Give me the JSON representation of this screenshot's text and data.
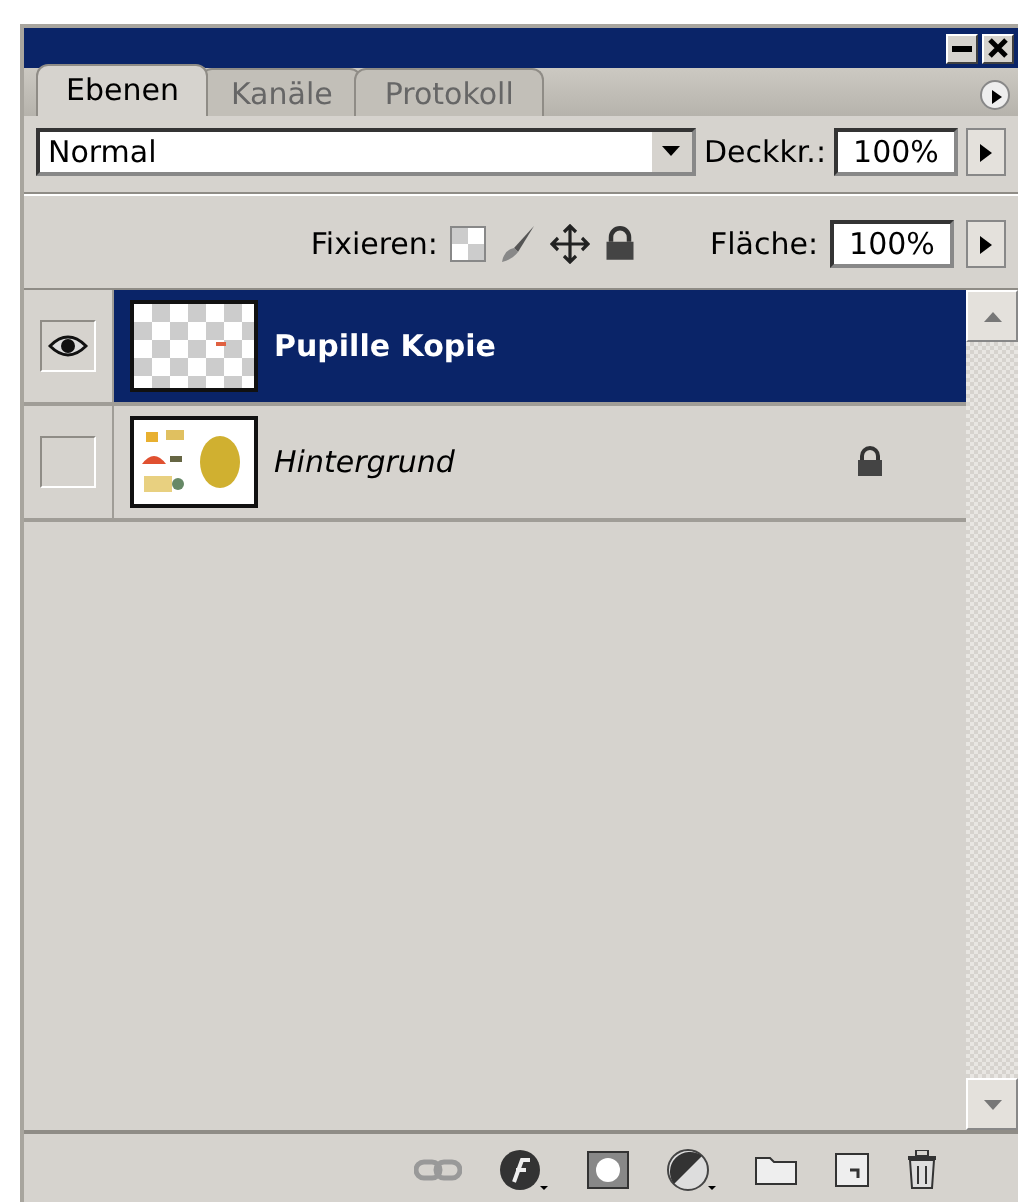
{
  "tabs": [
    {
      "label": "Ebenen",
      "selected": true
    },
    {
      "label": "Kanäle",
      "selected": false
    },
    {
      "label": "Protokoll",
      "selected": false
    }
  ],
  "blend_mode": {
    "value": "Normal"
  },
  "opacity": {
    "label": "Deckkr.:",
    "value": "100%"
  },
  "lock": {
    "label": "Fixieren:"
  },
  "fill": {
    "label": "Fläche:",
    "value": "100%"
  },
  "layers": [
    {
      "name": "Pupille Kopie",
      "visible": true,
      "selected": true,
      "locked": false,
      "italic": false,
      "kind": "transparent"
    },
    {
      "name": "Hintergrund",
      "visible": false,
      "selected": false,
      "locked": true,
      "italic": true,
      "kind": "image"
    }
  ]
}
